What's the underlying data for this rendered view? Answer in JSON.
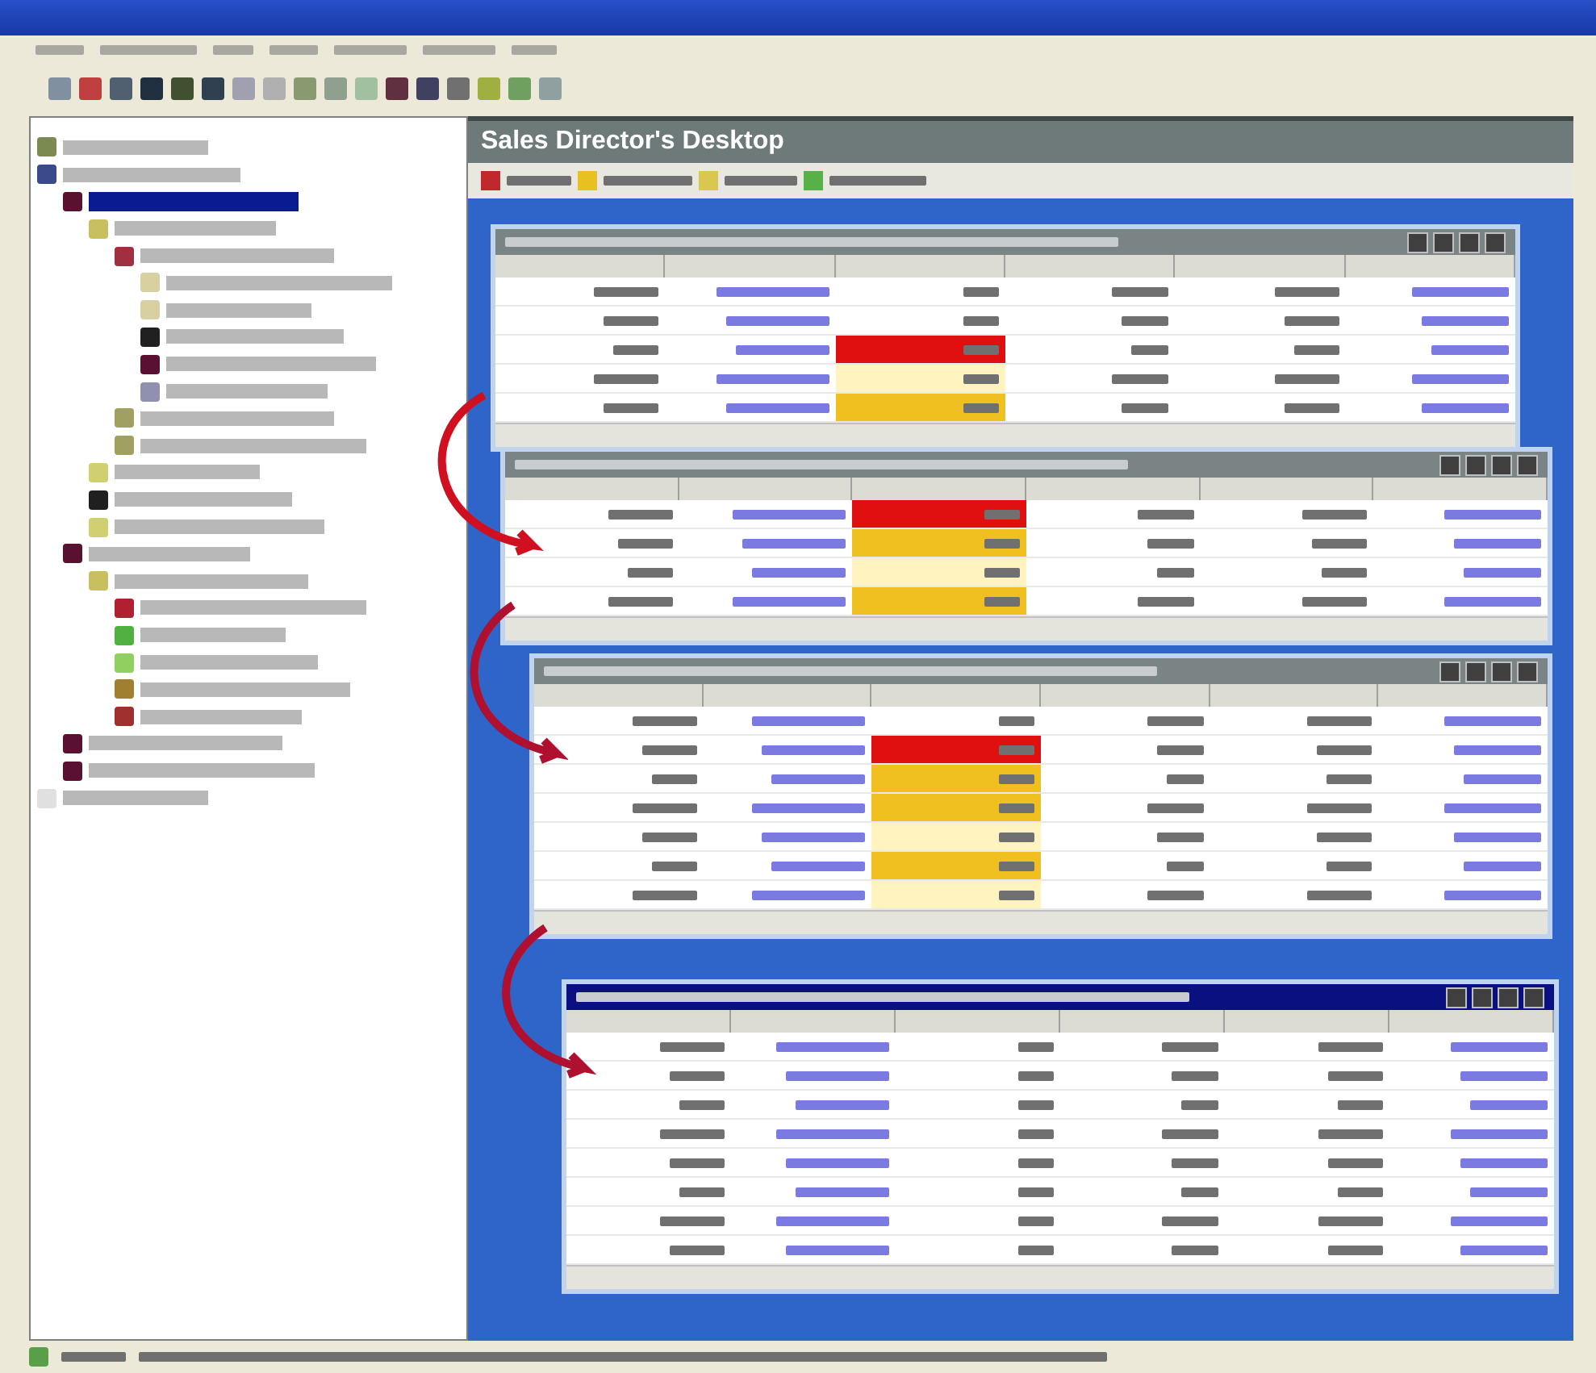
{
  "heading": "Sales Director's Desktop",
  "legend": [
    {
      "color": "#c0282b"
    },
    {
      "color": "#e8c020"
    },
    {
      "color": "#d8c850"
    },
    {
      "color": "#58b048"
    }
  ],
  "tree": [
    {
      "color": "#7a8a50",
      "selected": false
    },
    {
      "color": "#3a4a8a",
      "selected": false,
      "children": [
        {
          "color": "#5a1030",
          "selected": true,
          "children": [
            {
              "color": "#c8c060",
              "selected": false,
              "children": [
                {
                  "color": "#a03040",
                  "selected": false,
                  "children": [
                    {
                      "color": "#d8d0a0",
                      "selected": false
                    },
                    {
                      "color": "#d8d0a0",
                      "selected": false
                    },
                    {
                      "color": "#202020",
                      "selected": false
                    },
                    {
                      "color": "#5a1030",
                      "selected": false
                    },
                    {
                      "color": "#9090b0",
                      "selected": false
                    }
                  ]
                },
                {
                  "color": "#a0a060",
                  "selected": false
                },
                {
                  "color": "#a0a060",
                  "selected": false
                }
              ]
            },
            {
              "color": "#d0d070",
              "selected": false
            },
            {
              "color": "#202020",
              "selected": false
            },
            {
              "color": "#d0d070",
              "selected": false
            }
          ]
        },
        {
          "color": "#5a1030",
          "selected": false,
          "children": [
            {
              "color": "#c8c060",
              "selected": false,
              "children": [
                {
                  "color": "#b02030",
                  "selected": false
                },
                {
                  "color": "#50b040",
                  "selected": false
                },
                {
                  "color": "#90d060",
                  "selected": false
                },
                {
                  "color": "#a08030",
                  "selected": false
                },
                {
                  "color": "#a03030",
                  "selected": false
                }
              ]
            }
          ]
        },
        {
          "color": "#5a1030",
          "selected": false
        },
        {
          "color": "#5a1030",
          "selected": false
        }
      ]
    },
    {
      "color": "#e0e0e0",
      "selected": false
    }
  ],
  "panels": [
    {
      "kind": "grey",
      "rows": [
        {
          "color": "#ffffff"
        },
        {
          "color": "#ffffff"
        },
        {
          "color": "#e01010"
        },
        {
          "color": "#fff4c0"
        },
        {
          "color": "#f0c020"
        }
      ]
    },
    {
      "kind": "grey",
      "rows": [
        {
          "color": "#e01010"
        },
        {
          "color": "#f0c020"
        },
        {
          "color": "#fff4c0"
        },
        {
          "color": "#f0c020"
        }
      ]
    },
    {
      "kind": "grey",
      "rows": [
        {
          "color": "#ffffff"
        },
        {
          "color": "#e01010"
        },
        {
          "color": "#f0c020"
        },
        {
          "color": "#f0c020"
        },
        {
          "color": "#fff4c0"
        },
        {
          "color": "#f0c020"
        },
        {
          "color": "#fff4c0"
        }
      ]
    },
    {
      "kind": "navy",
      "rows": [
        {
          "color": "#ffffff"
        },
        {
          "color": "#ffffff"
        },
        {
          "color": "#ffffff"
        },
        {
          "color": "#ffffff"
        },
        {
          "color": "#ffffff"
        },
        {
          "color": "#ffffff"
        },
        {
          "color": "#ffffff"
        },
        {
          "color": "#ffffff"
        }
      ]
    }
  ]
}
